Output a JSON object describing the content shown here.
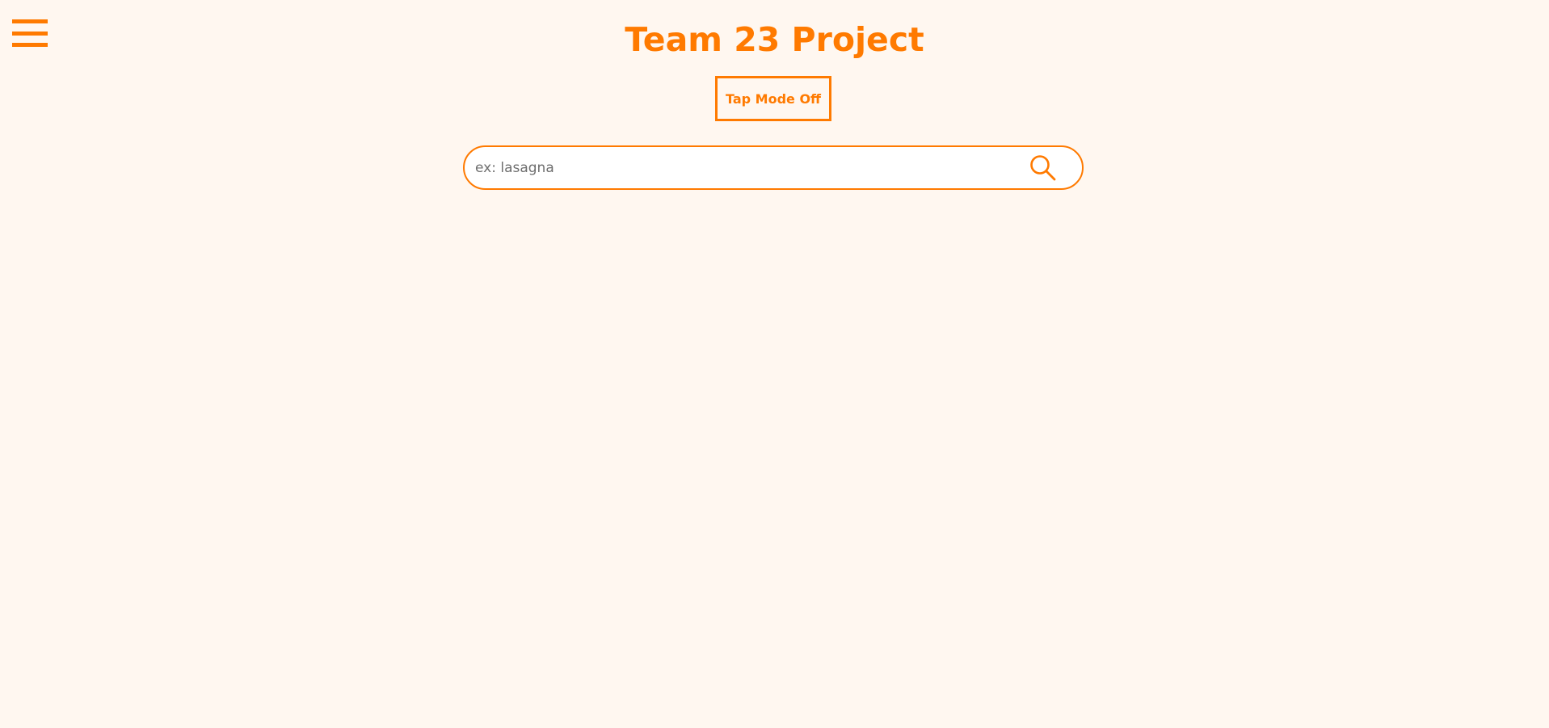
{
  "header": {
    "title": "Team 23 Project",
    "menu_icon": "hamburger-menu-icon"
  },
  "tap_mode": {
    "label": "Tap Mode Off"
  },
  "search": {
    "value": "",
    "placeholder": "ex: lasagna",
    "icon": "search-icon"
  },
  "colors": {
    "accent": "#ff7a00",
    "background": "#fff7f0",
    "input_background": "#ffffff",
    "placeholder": "#6e6e6e"
  }
}
